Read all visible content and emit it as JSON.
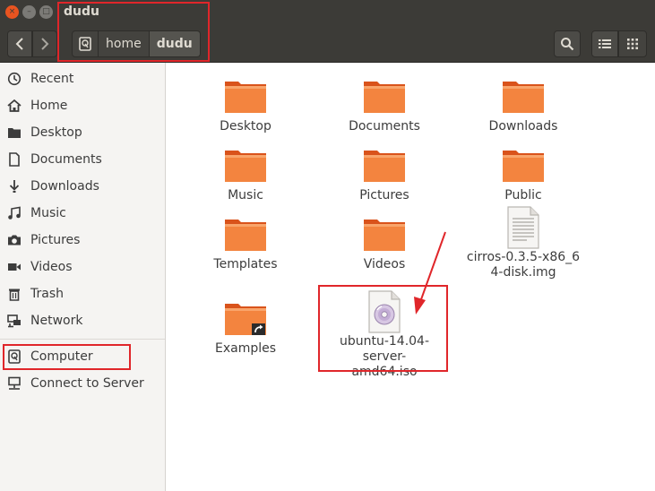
{
  "window": {
    "title": "dudu",
    "close_glyph": "×",
    "min_glyph": "–",
    "max_glyph": "□"
  },
  "toolbar": {
    "breadcrumbs": [
      {
        "label": "home"
      },
      {
        "label": "dudu"
      }
    ]
  },
  "sidebar": {
    "items": [
      {
        "label": "Recent",
        "icon": "clock-icon"
      },
      {
        "label": "Home",
        "icon": "home-icon"
      },
      {
        "label": "Desktop",
        "icon": "folder-icon"
      },
      {
        "label": "Documents",
        "icon": "document-icon"
      },
      {
        "label": "Downloads",
        "icon": "download-icon"
      },
      {
        "label": "Music",
        "icon": "music-icon"
      },
      {
        "label": "Pictures",
        "icon": "camera-icon"
      },
      {
        "label": "Videos",
        "icon": "video-icon"
      },
      {
        "label": "Trash",
        "icon": "trash-icon"
      },
      {
        "label": "Network",
        "icon": "network-icon"
      },
      {
        "label": "Computer",
        "icon": "drive-icon"
      },
      {
        "label": "Connect to Server",
        "icon": "server-icon"
      }
    ]
  },
  "files": [
    {
      "name": "Desktop",
      "type": "folder"
    },
    {
      "name": "Documents",
      "type": "folder"
    },
    {
      "name": "Downloads",
      "type": "folder"
    },
    {
      "name": "Music",
      "type": "folder"
    },
    {
      "name": "Pictures",
      "type": "folder"
    },
    {
      "name": "Public",
      "type": "folder"
    },
    {
      "name": "Templates",
      "type": "folder"
    },
    {
      "name": "Videos",
      "type": "folder"
    },
    {
      "name": "cirros-0.3.5-x86_64-disk.img",
      "type": "file"
    },
    {
      "name": "Examples",
      "type": "folder-link"
    },
    {
      "name": "ubuntu-14.04-server-amd64.iso",
      "type": "disc-image"
    }
  ],
  "colors": {
    "accent": "#e95420",
    "annotation": "#e0262a",
    "toolbar_bg": "#3c3b37"
  }
}
